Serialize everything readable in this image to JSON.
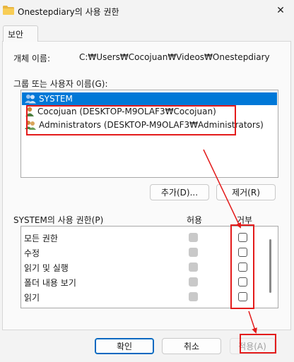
{
  "window": {
    "title": "Onestepdiary의 사용 권한",
    "close_glyph": "✕"
  },
  "tabs": [
    {
      "label": "보안"
    }
  ],
  "object": {
    "label": "개체 이름:",
    "value": "C:₩Users₩Cocojuan₩Videos₩Onestepdiary"
  },
  "groups": {
    "label": "그룹 또는 사용자 이름(G):",
    "items": [
      {
        "name": "SYSTEM",
        "icon": "system-users-icon",
        "selected": true
      },
      {
        "name": "Cocojuan (DESKTOP-M9OLAF3₩Cocojuan)",
        "icon": "user-icon",
        "selected": false
      },
      {
        "name": "Administrators (DESKTOP-M9OLAF3₩Administrators)",
        "icon": "admin-group-icon",
        "selected": false
      }
    ]
  },
  "group_buttons": {
    "add": "추가(D)...",
    "remove": "제거(R)"
  },
  "permissions": {
    "title": "SYSTEM의 사용 권한(P)",
    "col_allow": "허용",
    "col_deny": "거부",
    "rows": [
      {
        "name": "모든 권한",
        "allow": true,
        "deny": false
      },
      {
        "name": "수정",
        "allow": true,
        "deny": false
      },
      {
        "name": "읽기 및 실행",
        "allow": true,
        "deny": false
      },
      {
        "name": "폴더 내용 보기",
        "allow": true,
        "deny": false
      },
      {
        "name": "읽기",
        "allow": true,
        "deny": false
      }
    ]
  },
  "footer": {
    "ok": "확인",
    "cancel": "취소",
    "apply": "적용(A)"
  },
  "colors": {
    "accent": "#0078d7",
    "highlight": "#e31b1b"
  }
}
